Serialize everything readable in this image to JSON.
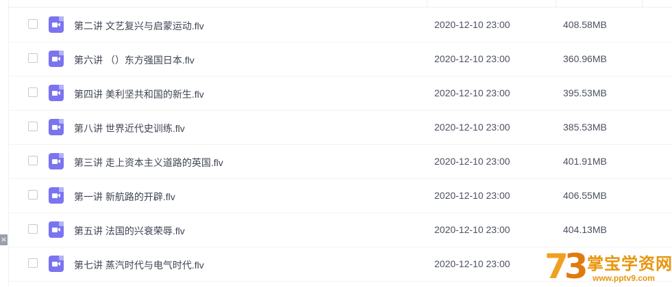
{
  "files": [
    {
      "name": "第二讲 文艺复兴与启蒙运动.flv",
      "date": "2020-12-10 23:00",
      "size": "408.58MB"
    },
    {
      "name": "第六讲 （）东方强国日本.flv",
      "date": "2020-12-10 23:00",
      "size": "360.96MB"
    },
    {
      "name": "第四讲 美利坚共和国的新生.flv",
      "date": "2020-12-10 23:00",
      "size": "395.53MB"
    },
    {
      "name": "第八讲 世界近代史训练.flv",
      "date": "2020-12-10 23:00",
      "size": "385.53MB"
    },
    {
      "name": "第三讲 走上资本主义道路的英国.flv",
      "date": "2020-12-10 23:00",
      "size": "401.91MB"
    },
    {
      "name": "第一讲 新航路的开辟.flv",
      "date": "2020-12-10 23:00",
      "size": "406.55MB"
    },
    {
      "name": "第五讲 法国的兴衰荣辱.flv",
      "date": "2020-12-10 23:00",
      "size": "404.13MB"
    },
    {
      "name": "第七讲 蒸汽时代与电气时代.flv",
      "date": "2020-12-10 23:00",
      "size": ""
    }
  ],
  "side_close_glyph": "×",
  "watermark": {
    "logo_mark": "7",
    "logo_mark_2": "3",
    "site_name": "掌宝学资网",
    "url": "www.pptv9.com"
  },
  "colors": {
    "file_icon": "#7a74f0",
    "watermark": "#e8950c"
  },
  "icons": {
    "file_type": "video-file-icon",
    "checkbox": "checkbox-icon"
  }
}
